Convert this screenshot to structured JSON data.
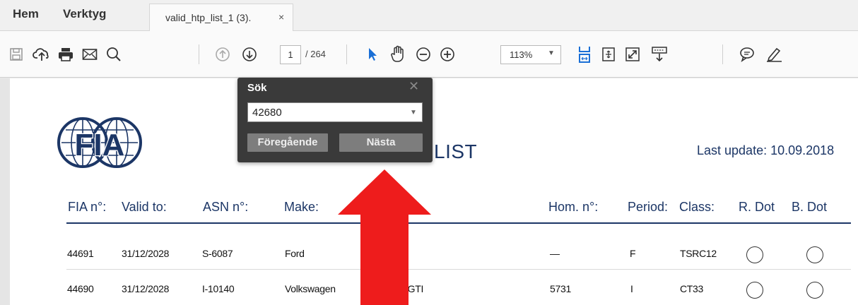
{
  "menu": {
    "home": "Hem",
    "tools": "Verktyg"
  },
  "tab": {
    "title": "valid_htp_list_1 (3).",
    "close": "×"
  },
  "toolbar": {
    "page_current": "1",
    "page_total": "/ 264",
    "zoom": "113%",
    "icons": [
      "save-icon",
      "cloud-upload-icon",
      "print-icon",
      "email-icon",
      "search-icon",
      "prev-page-icon",
      "next-page-icon",
      "select-cursor-icon",
      "hand-icon",
      "zoom-out-icon",
      "zoom-in-icon",
      "fit-width-icon",
      "page-fit-icon",
      "full-screen-icon",
      "scroll-mode-icon",
      "comment-icon",
      "highlight-pen-icon"
    ]
  },
  "document": {
    "title": "LIST",
    "last_update": "Last update: 10.09.2018",
    "logo_text": "FIA",
    "headers": [
      "FIA n°:",
      "Valid to:",
      "ASN n°:",
      "Make:",
      "Hom. n°:",
      "Period:",
      "Class:",
      "R. Dot",
      "B. Dot"
    ],
    "rows": [
      {
        "fia": "44691",
        "valid": "31/12/2028",
        "asn": "S-6087",
        "make": "Ford",
        "model": "",
        "hom": "—",
        "period": "F",
        "class": "TSRC12"
      },
      {
        "fia": "44690",
        "valid": "31/12/2028",
        "asn": "I-10140",
        "make": "Volkswagen",
        "model": "17 Golf GTI",
        "hom": "5731",
        "period": "I",
        "class": "CT33"
      }
    ]
  },
  "find": {
    "title": "Sök",
    "value": "42680",
    "prev_label": "Föregående",
    "next_label": "Nästa"
  },
  "colors": {
    "brand_navy": "#1c3666",
    "annotation_red": "#ee1c1c",
    "popup_bg": "#3a3a3a",
    "link_blue": "#1a6fd6"
  }
}
